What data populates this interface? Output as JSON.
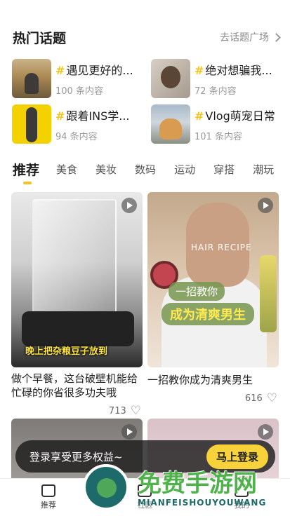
{
  "topics": {
    "title": "热门话题",
    "more_label": "去话题广场",
    "items": [
      {
        "hash": "#",
        "name": "遇见更好的...",
        "count": "100 条内容"
      },
      {
        "hash": "#",
        "name": "绝对想骗我...",
        "count": "72 条内容"
      },
      {
        "hash": "#",
        "name": "跟着INS学...",
        "count": "94 条内容"
      },
      {
        "hash": "#",
        "name": "Vlog萌宠日常",
        "count": "101 条内容"
      }
    ]
  },
  "tabs": [
    {
      "label": "推荐",
      "active": true
    },
    {
      "label": "美食"
    },
    {
      "label": "美妆"
    },
    {
      "label": "数码"
    },
    {
      "label": "运动"
    },
    {
      "label": "穿搭"
    },
    {
      "label": "潮玩"
    }
  ],
  "feed": [
    {
      "overlay_caption": "晚上把杂粮豆子放到",
      "title": "做个早餐，这台破壁机能给忙碌的你省很多功夫哦",
      "likes": "713"
    },
    {
      "overlay_title": "HAIR RECIPE",
      "overlay_line1": "一招教你",
      "overlay_line2": "成为清爽男生",
      "title": "一招教你成为清爽男生",
      "likes": "616"
    }
  ],
  "login_banner": {
    "text": "登录享受更多权益~",
    "button": "马上登录"
  },
  "bottom_nav": [
    {
      "label": "推荐",
      "icon": "home-icon"
    },
    {
      "label": "社区",
      "icon": "community-icon"
    },
    {
      "label": "我的",
      "icon": "profile-icon"
    }
  ],
  "watermark": {
    "title": "免费手游网",
    "subtitle": "MIANFEISHOUYOUWANG"
  },
  "colors": {
    "accent": "#f2c61f",
    "login_button": "#f7d23a",
    "banner_bg": "#141414",
    "watermark_green": "#4fb24b"
  }
}
